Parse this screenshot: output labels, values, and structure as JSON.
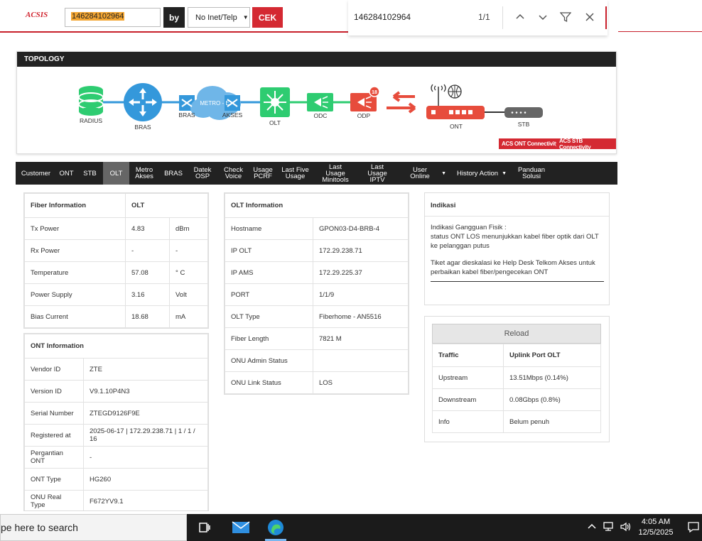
{
  "header": {
    "logo_text": "ACSIS",
    "search_value": "146284102964",
    "by_label": "by",
    "select_value": "No Inet/Telp",
    "cek_label": "CEK"
  },
  "findbar": {
    "query": "146284102964",
    "count": "1/1"
  },
  "topology": {
    "title": "TOPOLOGY",
    "nodes": {
      "radius": "RADIUS",
      "bras": "BRAS",
      "bras2": "BRAS",
      "metro": "METRO - E",
      "akses": "AKSES",
      "olt": "OLT",
      "odc": "ODC",
      "odp": "ODP",
      "odp_badge": "18",
      "ont": "ONT",
      "stb": "STB"
    },
    "btn_ont": "ACS ONT Connectivity",
    "btn_stb": "ACS STB Connectivity"
  },
  "tabs": [
    {
      "label": "Customer"
    },
    {
      "label": "ONT"
    },
    {
      "label": "STB"
    },
    {
      "label": "OLT"
    },
    {
      "label": "Metro Akses"
    },
    {
      "label": "BRAS"
    },
    {
      "label": "Datek OSP"
    },
    {
      "label": "Check Voice"
    },
    {
      "label": "Usage PCRF"
    },
    {
      "label": "Last Five Usage"
    },
    {
      "label": "Last Usage Minitools"
    },
    {
      "label": "Last Usage IPTV"
    },
    {
      "label": "User Online"
    },
    {
      "label": "History Action"
    },
    {
      "label": "Panduan Solusi"
    }
  ],
  "fiber": {
    "h1": "Fiber Information",
    "h2": "OLT",
    "rows": [
      {
        "label": "Tx Power",
        "value": "4.83",
        "unit": "dBm"
      },
      {
        "label": "Rx Power",
        "value": "-",
        "unit": "-"
      },
      {
        "label": "Temperature",
        "value": "57.08",
        "unit": "° C"
      },
      {
        "label": "Power Supply",
        "value": "3.16",
        "unit": "Volt"
      },
      {
        "label": "Bias Current",
        "value": "18.68",
        "unit": "mA"
      }
    ]
  },
  "ont": {
    "title": "ONT Information",
    "rows": [
      {
        "label": "Vendor ID",
        "value": "ZTE"
      },
      {
        "label": "Version ID",
        "value": "V9.1.10P4N3"
      },
      {
        "label": "Serial Number",
        "value": "ZTEGD9126F9E"
      },
      {
        "label": "Registered at",
        "value": "2025-06-17 | 172.29.238.71 | 1 / 1 / 16"
      },
      {
        "label": "Pergantian ONT",
        "value": "-"
      },
      {
        "label": "ONT Type",
        "value": "HG260"
      },
      {
        "label": "ONU Real Type",
        "value": "F672YV9.1"
      }
    ]
  },
  "olt": {
    "title": "OLT Information",
    "rows": [
      {
        "label": "Hostname",
        "value": "GPON03-D4-BRB-4"
      },
      {
        "label": "IP OLT",
        "value": "172.29.238.71"
      },
      {
        "label": "IP AMS",
        "value": "172.29.225.37"
      },
      {
        "label": "PORT",
        "value": "1/1/9"
      },
      {
        "label": "OLT Type",
        "value": "Fiberhome - AN5516"
      },
      {
        "label": "Fiber Length",
        "value": "7821 M"
      },
      {
        "label": "ONU Admin Status",
        "value": ""
      },
      {
        "label": "ONU Link Status",
        "value": "LOS"
      }
    ]
  },
  "indikasi": {
    "title": "Indikasi",
    "line1": "Indikasi Gangguan Fisik :",
    "line2": "status ONT LOS menunjukkan kabel fiber optik dari OLT ke pelanggan putus",
    "line3": "Tiket agar dieskalasi ke Help Desk Telkom Akses untuk perbaikan kabel fiber/pengecekan ONT"
  },
  "traffic": {
    "reload": "Reload",
    "h1": "Traffic",
    "h2": "Uplink Port OLT",
    "rows": [
      {
        "label": "Upstream",
        "value": "13.51Mbps (0.14%)"
      },
      {
        "label": "Downstream",
        "value": "0.08Gbps (0.8%)"
      },
      {
        "label": "Info",
        "value": "Belum penuh"
      }
    ]
  },
  "taskbar": {
    "search_text": "pe here to search",
    "time": "4:05 AM",
    "date": "12/5/2025"
  },
  "colors": {
    "brand_red": "#d42932",
    "dark": "#222222",
    "green": "#2ecc71",
    "blue": "#3498db"
  }
}
